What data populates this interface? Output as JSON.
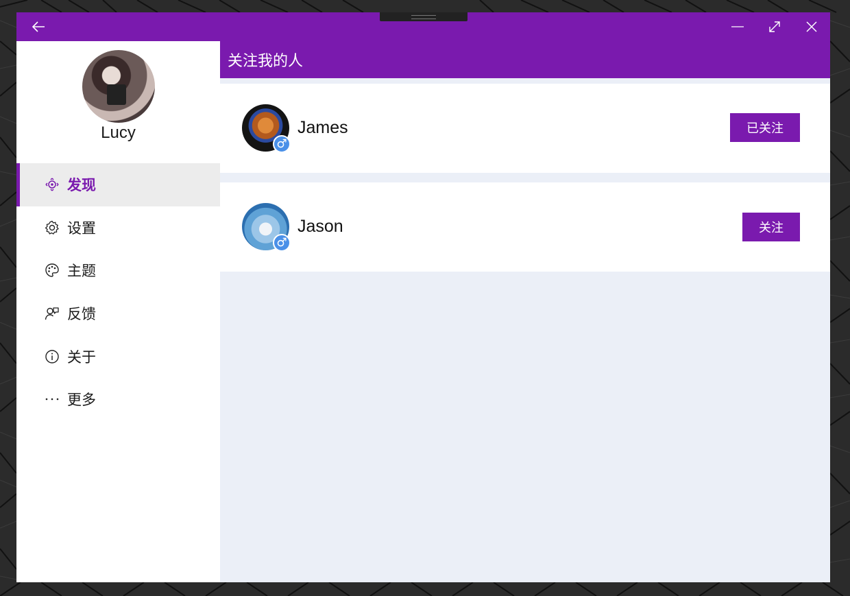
{
  "window": {
    "controls": {
      "back_icon": "arrow-left-icon",
      "minimize_icon": "minimize-icon",
      "maximize_icon": "maximize-icon",
      "close_icon": "close-icon"
    }
  },
  "sidebar": {
    "profile": {
      "name": "Lucy"
    },
    "items": [
      {
        "label": "发现",
        "icon": "compass-icon",
        "active": true
      },
      {
        "label": "设置",
        "icon": "gear-icon",
        "active": false
      },
      {
        "label": "主题",
        "icon": "palette-icon",
        "active": false
      },
      {
        "label": "反馈",
        "icon": "feedback-icon",
        "active": false
      },
      {
        "label": "关于",
        "icon": "info-icon",
        "active": false
      },
      {
        "label": "更多",
        "icon": "more-icon",
        "active": false
      }
    ]
  },
  "main": {
    "title": "关注我的人",
    "followers": [
      {
        "name": "James",
        "gender_symbol": "♂",
        "button_label": "已关注"
      },
      {
        "name": "Jason",
        "gender_symbol": "♂",
        "button_label": "关注"
      }
    ]
  },
  "colors": {
    "accent": "#7a1aae",
    "badge": "#4a90e8",
    "content_bg": "#ebeff7"
  }
}
